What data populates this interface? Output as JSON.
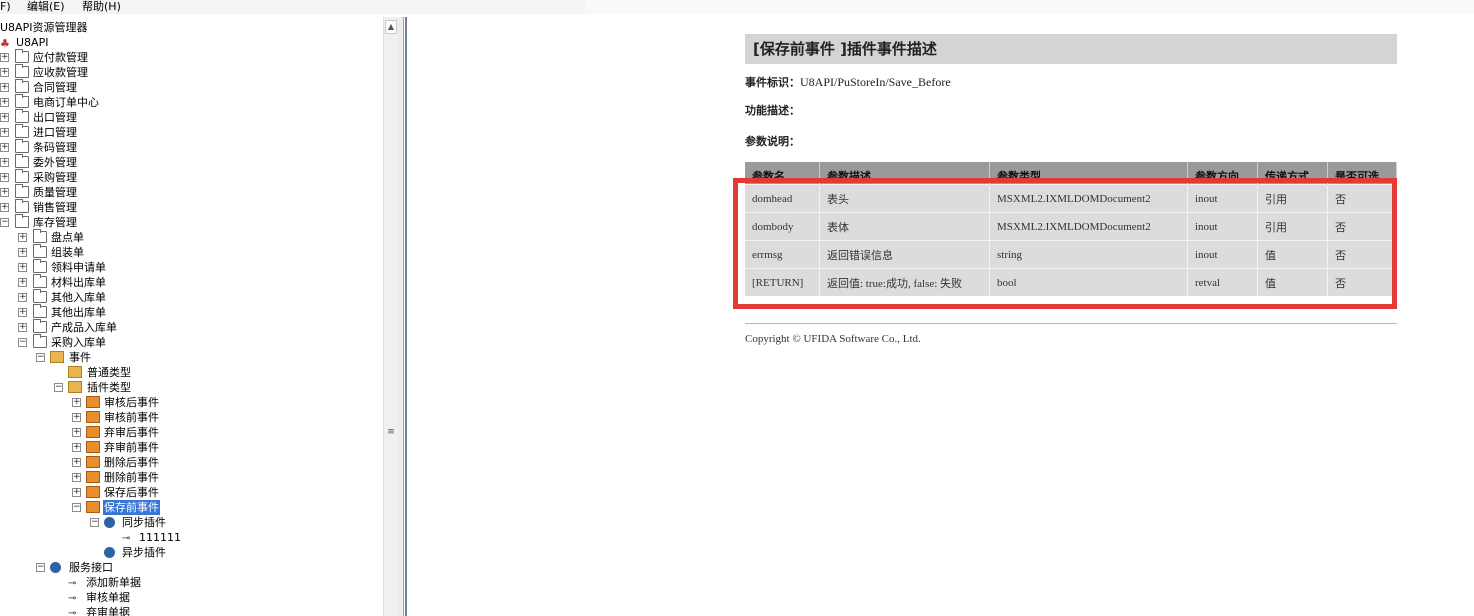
{
  "menu": {
    "fragment_label": "F)",
    "edit_label": "编辑(E)",
    "help_label": "帮助(H)"
  },
  "tree": {
    "title": "U8API资源管理器",
    "root": "U8API",
    "top_folders": [
      "应付款管理",
      "应收款管理",
      "合同管理",
      "电商订单中心",
      "出口管理",
      "进口管理",
      "条码管理",
      "委外管理",
      "采购管理",
      "质量管理",
      "销售管理",
      "库存管理"
    ],
    "inventory_children": [
      "盘点单",
      "组装单",
      "领料申请单",
      "材料出库单",
      "其他入库单",
      "其他出库单",
      "产成品入库单",
      "采购入库单"
    ],
    "events_label": "事件",
    "normal_type_label": "普通类型",
    "plugin_type_label": "插件类型",
    "plugin_events": [
      "审核后事件",
      "审核前事件",
      "弃审后事件",
      "弃审前事件",
      "删除后事件",
      "删除前事件",
      "保存后事件",
      "保存前事件"
    ],
    "sync_plugin_label": "同步插件",
    "sync_plugin_child": "111111",
    "async_plugin_label": "异步插件",
    "service_label": "服务接口",
    "service_items": [
      "添加新单据",
      "审核单据",
      "弃审单据"
    ]
  },
  "doc": {
    "title": "[保存前事件 ]插件事件描述",
    "event_id_label": "事件标识：",
    "event_id_value": "U8API/PuStoreIn/Save_Before",
    "function_label": "功能描述：",
    "params_label": "参数说明：",
    "table_headers": [
      "参数名",
      "参数描述",
      "参数类型",
      "参数方向",
      "传递方式",
      "是否可选"
    ],
    "rows": [
      [
        "domhead",
        "表头",
        "MSXML2.IXMLDOMDocument2",
        "inout",
        "引用",
        "否"
      ],
      [
        "dombody",
        "表体",
        "MSXML2.IXMLDOMDocument2",
        "inout",
        "引用",
        "否"
      ],
      [
        "errmsg",
        "返回错误信息",
        "string",
        "inout",
        "值",
        "否"
      ],
      [
        "[RETURN]",
        "返回值: true:成功, false: 失败",
        "bool",
        "retval",
        "值",
        "否"
      ]
    ],
    "copyright": "Copyright © UFIDA Software Co., Ltd."
  },
  "colors": {
    "highlight_box": "#e53935",
    "selected_bg": "#3875d7",
    "title_bar_bg": "#d4d4d4",
    "table_header_bg": "#9a9a9a",
    "table_row_bg": "#dcdcdc"
  }
}
